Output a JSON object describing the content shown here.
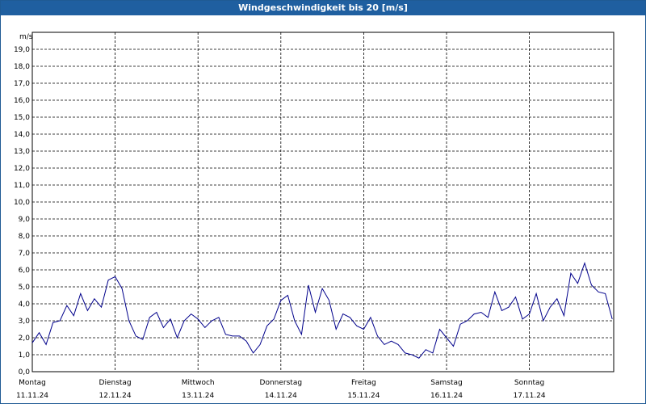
{
  "window": {
    "title": "Windgeschwindigkeit bis 20 [m/s]"
  },
  "chart_data": {
    "type": "line",
    "title": "Windgeschwindigkeit bis 20 [m/s]",
    "ylabel": "m/s",
    "xlabel": "",
    "ylim": [
      0,
      20
    ],
    "yticks": [
      "0,0",
      "1,0",
      "2,0",
      "3,0",
      "4,0",
      "5,0",
      "6,0",
      "7,0",
      "8,0",
      "9,0",
      "10,0",
      "11,0",
      "12,0",
      "13,0",
      "14,0",
      "15,0",
      "16,0",
      "17,0",
      "18,0",
      "19,0"
    ],
    "days": [
      {
        "weekday": "Montag",
        "date": "11.11.24"
      },
      {
        "weekday": "Dienstag",
        "date": "12.11.24"
      },
      {
        "weekday": "Mittwoch",
        "date": "13.11.24"
      },
      {
        "weekday": "Donnerstag",
        "date": "14.11.24"
      },
      {
        "weekday": "Freitag",
        "date": "15.11.24"
      },
      {
        "weekday": "Samstag",
        "date": "16.11.24"
      },
      {
        "weekday": "Sonntag",
        "date": "17.11.24"
      }
    ],
    "grid": true,
    "line_color": "#00008b",
    "series": [
      {
        "x_hours": [
          0,
          2,
          4,
          6,
          8,
          10,
          12,
          14,
          16,
          18,
          20,
          22,
          24,
          26,
          28,
          30,
          32,
          34,
          36,
          38,
          40,
          42,
          44,
          46,
          48,
          50,
          52,
          54,
          56,
          58,
          60,
          62,
          64,
          66,
          68,
          70,
          72,
          74,
          76,
          78,
          80,
          82,
          84,
          86,
          88,
          90,
          92,
          94,
          96,
          98,
          100,
          102,
          104,
          106,
          108,
          110,
          112,
          114,
          116,
          118,
          120,
          122,
          124,
          126,
          128,
          130,
          132,
          134,
          136,
          138,
          140,
          142,
          144,
          146,
          148,
          150,
          152,
          154,
          156,
          158,
          160,
          162,
          164,
          166,
          168
        ],
        "values": [
          1.7,
          2.3,
          1.6,
          2.9,
          3.0,
          3.9,
          3.3,
          4.6,
          3.6,
          4.3,
          3.8,
          5.4,
          5.6,
          4.9,
          3.0,
          2.1,
          1.9,
          3.2,
          3.5,
          2.6,
          3.1,
          2.0,
          3.0,
          3.4,
          3.1,
          2.6,
          3.0,
          3.2,
          2.2,
          2.1,
          2.1,
          1.8,
          1.1,
          1.6,
          2.7,
          3.1,
          4.2,
          4.5,
          3.0,
          2.2,
          5.1,
          3.5,
          4.9,
          4.2,
          2.5,
          3.4,
          3.2,
          2.7,
          2.5,
          3.2,
          2.1,
          1.6,
          1.8,
          1.6,
          1.1,
          1.0,
          0.8,
          1.3,
          1.1,
          2.5,
          2.0,
          1.5,
          2.8,
          3.0,
          3.4,
          3.5,
          3.2,
          4.7,
          3.6,
          3.8,
          4.4,
          3.1,
          3.4,
          4.6,
          3.0,
          3.8,
          4.3,
          3.3,
          5.8,
          5.2,
          6.4,
          5.1,
          4.7,
          4.6,
          3.1
        ]
      }
    ]
  }
}
